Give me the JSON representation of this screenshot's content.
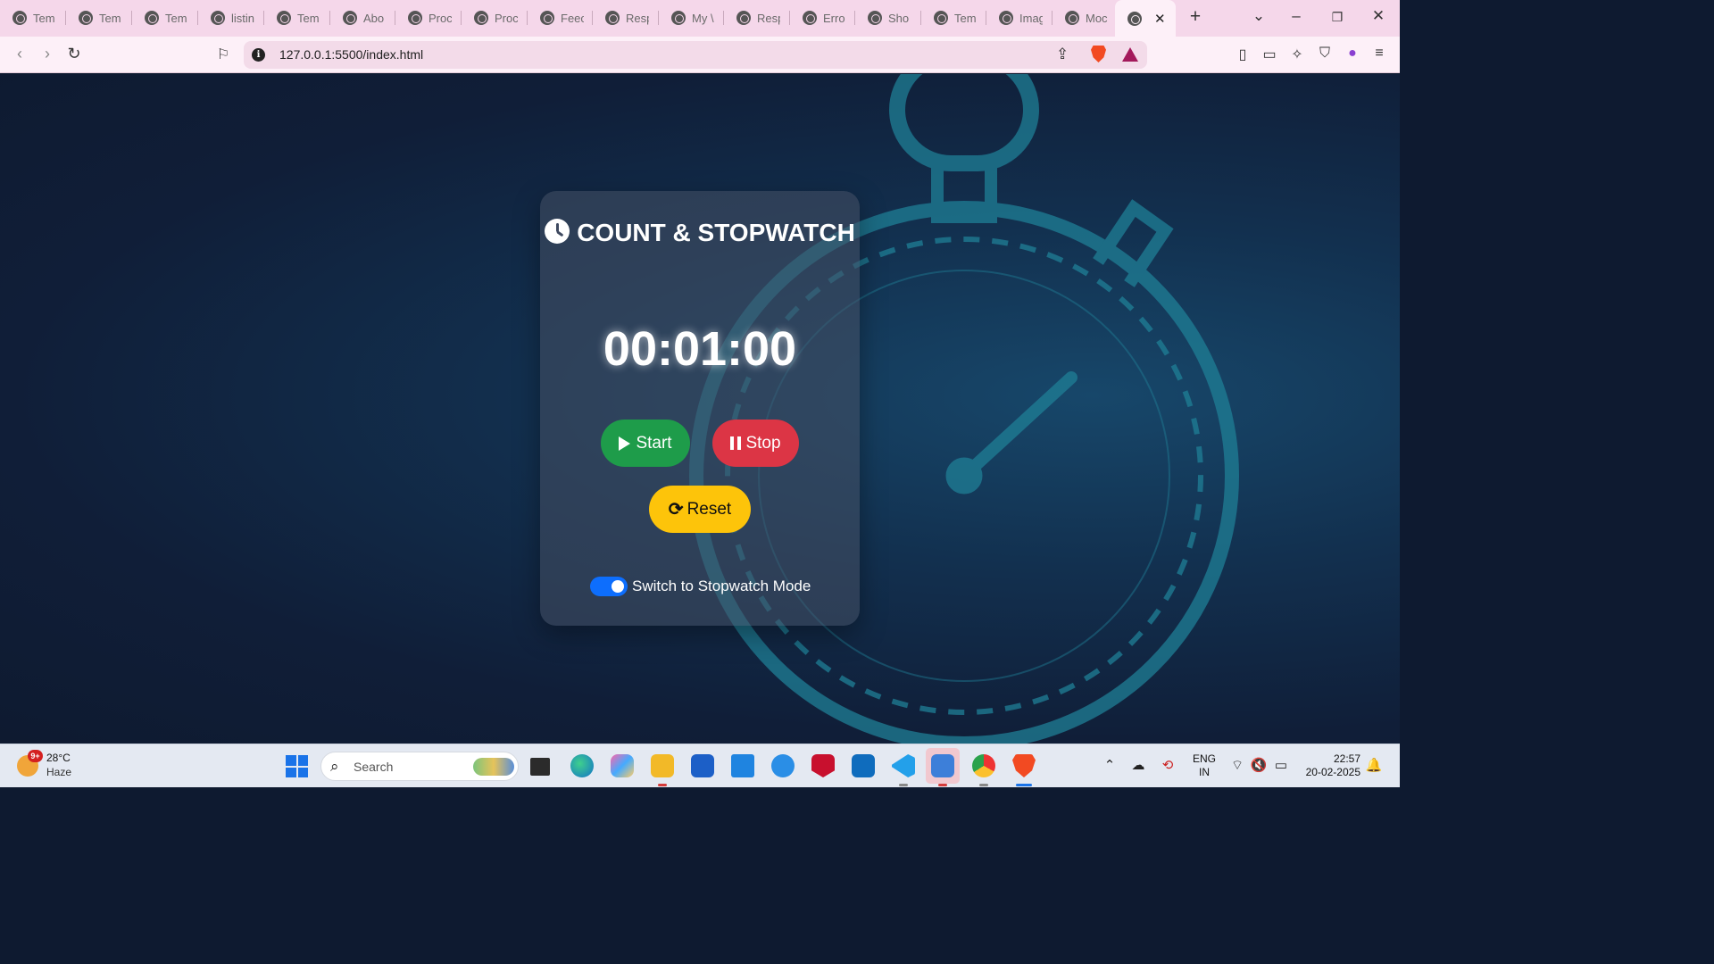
{
  "browser": {
    "tabs": [
      {
        "title": "Tem"
      },
      {
        "title": "Tem"
      },
      {
        "title": "Tem"
      },
      {
        "title": "listin"
      },
      {
        "title": "Tem"
      },
      {
        "title": "Abo"
      },
      {
        "title": "Proc"
      },
      {
        "title": "Proc"
      },
      {
        "title": "Feec"
      },
      {
        "title": "Resp"
      },
      {
        "title": "My \\"
      },
      {
        "title": "Resp"
      },
      {
        "title": "Erro"
      },
      {
        "title": "Sho"
      },
      {
        "title": "Tem"
      },
      {
        "title": "Imag"
      },
      {
        "title": "Moc"
      }
    ],
    "active_tab_close": "✕",
    "new_tab": "+",
    "url": "127.0.0.1:5500/index.html"
  },
  "app": {
    "title": "COUNT & STOPWATCH",
    "timer": "00:01:00",
    "start_label": "Start",
    "stop_label": "Stop",
    "reset_label": "Reset",
    "mode_toggle_label": "Switch to Stopwatch Mode",
    "mode_toggle_on": true
  },
  "taskbar": {
    "weather_badge": "9+",
    "temperature": "28°C",
    "weather": "Haze",
    "search_placeholder": "Search",
    "language_line1": "ENG",
    "language_line2": "IN",
    "time": "22:57",
    "date": "20-02-2025"
  },
  "colors": {
    "start": "#1e9c4a",
    "stop": "#dc3545",
    "reset": "#fdc40a",
    "toggle": "#0d6efd",
    "tabstrip": "#f5d7ea"
  }
}
